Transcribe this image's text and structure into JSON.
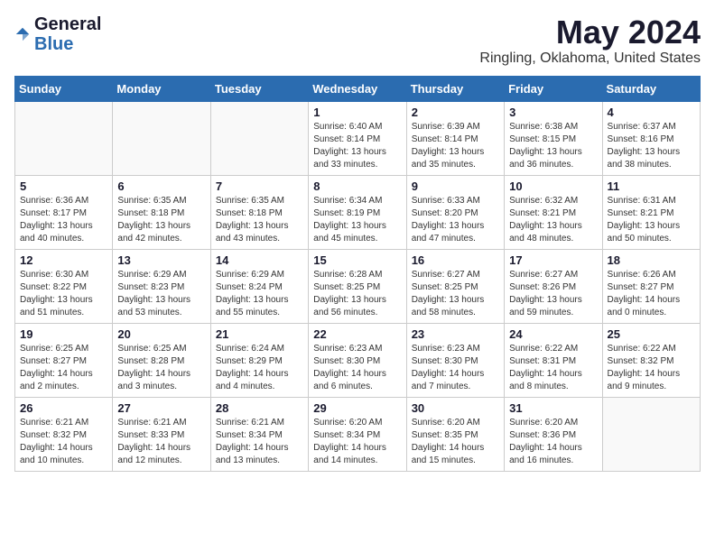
{
  "header": {
    "logo_general": "General",
    "logo_blue": "Blue",
    "month": "May 2024",
    "location": "Ringling, Oklahoma, United States"
  },
  "weekdays": [
    "Sunday",
    "Monday",
    "Tuesday",
    "Wednesday",
    "Thursday",
    "Friday",
    "Saturday"
  ],
  "weeks": [
    [
      {
        "day": "",
        "info": ""
      },
      {
        "day": "",
        "info": ""
      },
      {
        "day": "",
        "info": ""
      },
      {
        "day": "1",
        "info": "Sunrise: 6:40 AM\nSunset: 8:14 PM\nDaylight: 13 hours\nand 33 minutes."
      },
      {
        "day": "2",
        "info": "Sunrise: 6:39 AM\nSunset: 8:14 PM\nDaylight: 13 hours\nand 35 minutes."
      },
      {
        "day": "3",
        "info": "Sunrise: 6:38 AM\nSunset: 8:15 PM\nDaylight: 13 hours\nand 36 minutes."
      },
      {
        "day": "4",
        "info": "Sunrise: 6:37 AM\nSunset: 8:16 PM\nDaylight: 13 hours\nand 38 minutes."
      }
    ],
    [
      {
        "day": "5",
        "info": "Sunrise: 6:36 AM\nSunset: 8:17 PM\nDaylight: 13 hours\nand 40 minutes."
      },
      {
        "day": "6",
        "info": "Sunrise: 6:35 AM\nSunset: 8:18 PM\nDaylight: 13 hours\nand 42 minutes."
      },
      {
        "day": "7",
        "info": "Sunrise: 6:35 AM\nSunset: 8:18 PM\nDaylight: 13 hours\nand 43 minutes."
      },
      {
        "day": "8",
        "info": "Sunrise: 6:34 AM\nSunset: 8:19 PM\nDaylight: 13 hours\nand 45 minutes."
      },
      {
        "day": "9",
        "info": "Sunrise: 6:33 AM\nSunset: 8:20 PM\nDaylight: 13 hours\nand 47 minutes."
      },
      {
        "day": "10",
        "info": "Sunrise: 6:32 AM\nSunset: 8:21 PM\nDaylight: 13 hours\nand 48 minutes."
      },
      {
        "day": "11",
        "info": "Sunrise: 6:31 AM\nSunset: 8:21 PM\nDaylight: 13 hours\nand 50 minutes."
      }
    ],
    [
      {
        "day": "12",
        "info": "Sunrise: 6:30 AM\nSunset: 8:22 PM\nDaylight: 13 hours\nand 51 minutes."
      },
      {
        "day": "13",
        "info": "Sunrise: 6:29 AM\nSunset: 8:23 PM\nDaylight: 13 hours\nand 53 minutes."
      },
      {
        "day": "14",
        "info": "Sunrise: 6:29 AM\nSunset: 8:24 PM\nDaylight: 13 hours\nand 55 minutes."
      },
      {
        "day": "15",
        "info": "Sunrise: 6:28 AM\nSunset: 8:25 PM\nDaylight: 13 hours\nand 56 minutes."
      },
      {
        "day": "16",
        "info": "Sunrise: 6:27 AM\nSunset: 8:25 PM\nDaylight: 13 hours\nand 58 minutes."
      },
      {
        "day": "17",
        "info": "Sunrise: 6:27 AM\nSunset: 8:26 PM\nDaylight: 13 hours\nand 59 minutes."
      },
      {
        "day": "18",
        "info": "Sunrise: 6:26 AM\nSunset: 8:27 PM\nDaylight: 14 hours\nand 0 minutes."
      }
    ],
    [
      {
        "day": "19",
        "info": "Sunrise: 6:25 AM\nSunset: 8:27 PM\nDaylight: 14 hours\nand 2 minutes."
      },
      {
        "day": "20",
        "info": "Sunrise: 6:25 AM\nSunset: 8:28 PM\nDaylight: 14 hours\nand 3 minutes."
      },
      {
        "day": "21",
        "info": "Sunrise: 6:24 AM\nSunset: 8:29 PM\nDaylight: 14 hours\nand 4 minutes."
      },
      {
        "day": "22",
        "info": "Sunrise: 6:23 AM\nSunset: 8:30 PM\nDaylight: 14 hours\nand 6 minutes."
      },
      {
        "day": "23",
        "info": "Sunrise: 6:23 AM\nSunset: 8:30 PM\nDaylight: 14 hours\nand 7 minutes."
      },
      {
        "day": "24",
        "info": "Sunrise: 6:22 AM\nSunset: 8:31 PM\nDaylight: 14 hours\nand 8 minutes."
      },
      {
        "day": "25",
        "info": "Sunrise: 6:22 AM\nSunset: 8:32 PM\nDaylight: 14 hours\nand 9 minutes."
      }
    ],
    [
      {
        "day": "26",
        "info": "Sunrise: 6:21 AM\nSunset: 8:32 PM\nDaylight: 14 hours\nand 10 minutes."
      },
      {
        "day": "27",
        "info": "Sunrise: 6:21 AM\nSunset: 8:33 PM\nDaylight: 14 hours\nand 12 minutes."
      },
      {
        "day": "28",
        "info": "Sunrise: 6:21 AM\nSunset: 8:34 PM\nDaylight: 14 hours\nand 13 minutes."
      },
      {
        "day": "29",
        "info": "Sunrise: 6:20 AM\nSunset: 8:34 PM\nDaylight: 14 hours\nand 14 minutes."
      },
      {
        "day": "30",
        "info": "Sunrise: 6:20 AM\nSunset: 8:35 PM\nDaylight: 14 hours\nand 15 minutes."
      },
      {
        "day": "31",
        "info": "Sunrise: 6:20 AM\nSunset: 8:36 PM\nDaylight: 14 hours\nand 16 minutes."
      },
      {
        "day": "",
        "info": ""
      }
    ]
  ]
}
